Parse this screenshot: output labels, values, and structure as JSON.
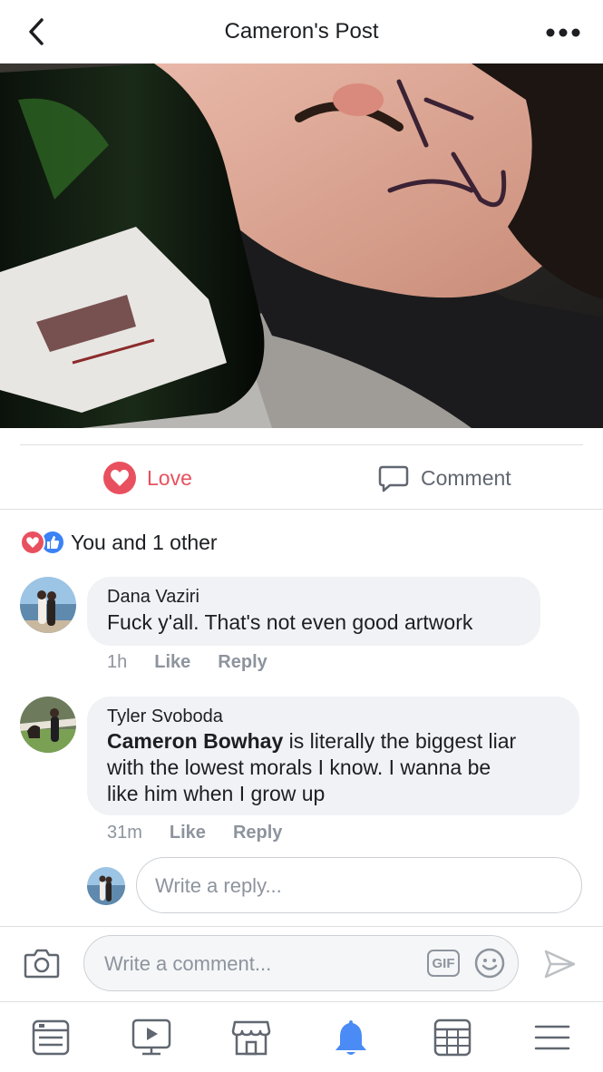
{
  "header": {
    "title": "Cameron's Post"
  },
  "actions": {
    "love_label": "Love",
    "comment_label": "Comment"
  },
  "reactions": {
    "summary": "You and 1 other"
  },
  "comments": [
    {
      "author": "Dana Vaziri",
      "text": "Fuck y'all. That's not even good artwork",
      "time": "1h",
      "like": "Like",
      "reply": "Reply"
    },
    {
      "author": "Tyler Svoboda",
      "mention": "Cameron Bowhay",
      "text_line1": " is literally the biggest liar",
      "text_line2": "with the lowest morals I know. I wanna be",
      "text_line3": "like him when I grow up",
      "time": "31m",
      "like": "Like",
      "reply": "Reply"
    }
  ],
  "reply_box": {
    "placeholder": "Write a reply..."
  },
  "composer": {
    "placeholder": "Write a comment...",
    "gif_label": "GIF"
  },
  "tabs": [
    "news-feed",
    "watch",
    "marketplace",
    "notifications",
    "events",
    "menu"
  ],
  "colors": {
    "love": "#e9505f",
    "like": "#3b82f6",
    "active_tab": "#4b8bf5",
    "inactive_icon": "#606770"
  }
}
